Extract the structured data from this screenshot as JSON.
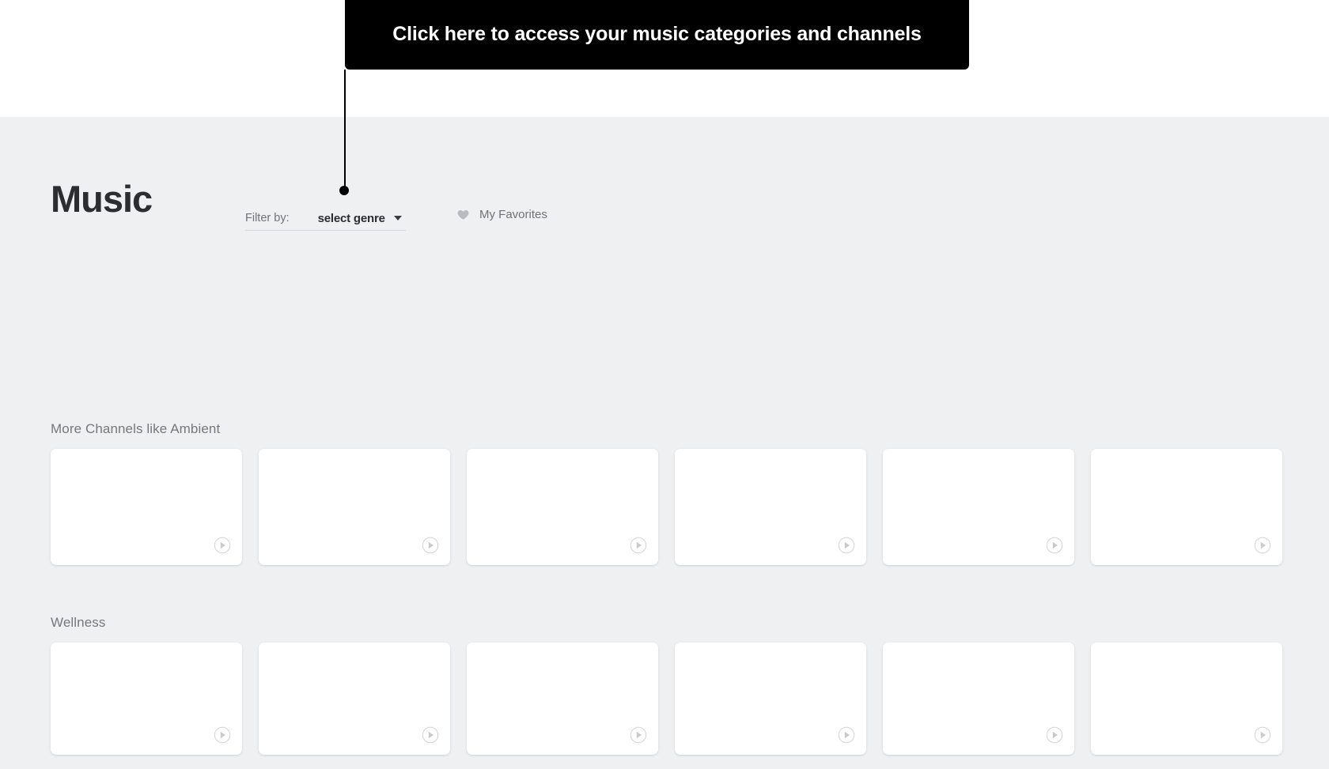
{
  "coachmark": {
    "text": "Click here to access your music categories and channels",
    "background": "#000000",
    "text_color": "#ffffff"
  },
  "header": {
    "title": "Music",
    "filter": {
      "label": "Filter by:",
      "selected_value": "select genre",
      "caret_icon": "chevron-down-icon"
    },
    "favorites": {
      "icon": "heart-icon",
      "label": "My Favorites"
    }
  },
  "theme": {
    "page_background": "#eff0f2",
    "strip_background": "#ffffff",
    "title_color": "#2b2d31",
    "muted_text": "#6e7277",
    "card_background": "#ffffff",
    "play_icon_color": "#c9cacc"
  },
  "sections": [
    {
      "title": "More Channels like Ambient",
      "cards": [
        {
          "play_icon": "play-circle-icon"
        },
        {
          "play_icon": "play-circle-icon"
        },
        {
          "play_icon": "play-circle-icon"
        },
        {
          "play_icon": "play-circle-icon"
        },
        {
          "play_icon": "play-circle-icon"
        },
        {
          "play_icon": "play-circle-icon"
        }
      ]
    },
    {
      "title": "Wellness",
      "cards": [
        {
          "play_icon": "play-circle-icon"
        },
        {
          "play_icon": "play-circle-icon"
        },
        {
          "play_icon": "play-circle-icon"
        },
        {
          "play_icon": "play-circle-icon"
        },
        {
          "play_icon": "play-circle-icon"
        },
        {
          "play_icon": "play-circle-icon"
        }
      ]
    }
  ]
}
